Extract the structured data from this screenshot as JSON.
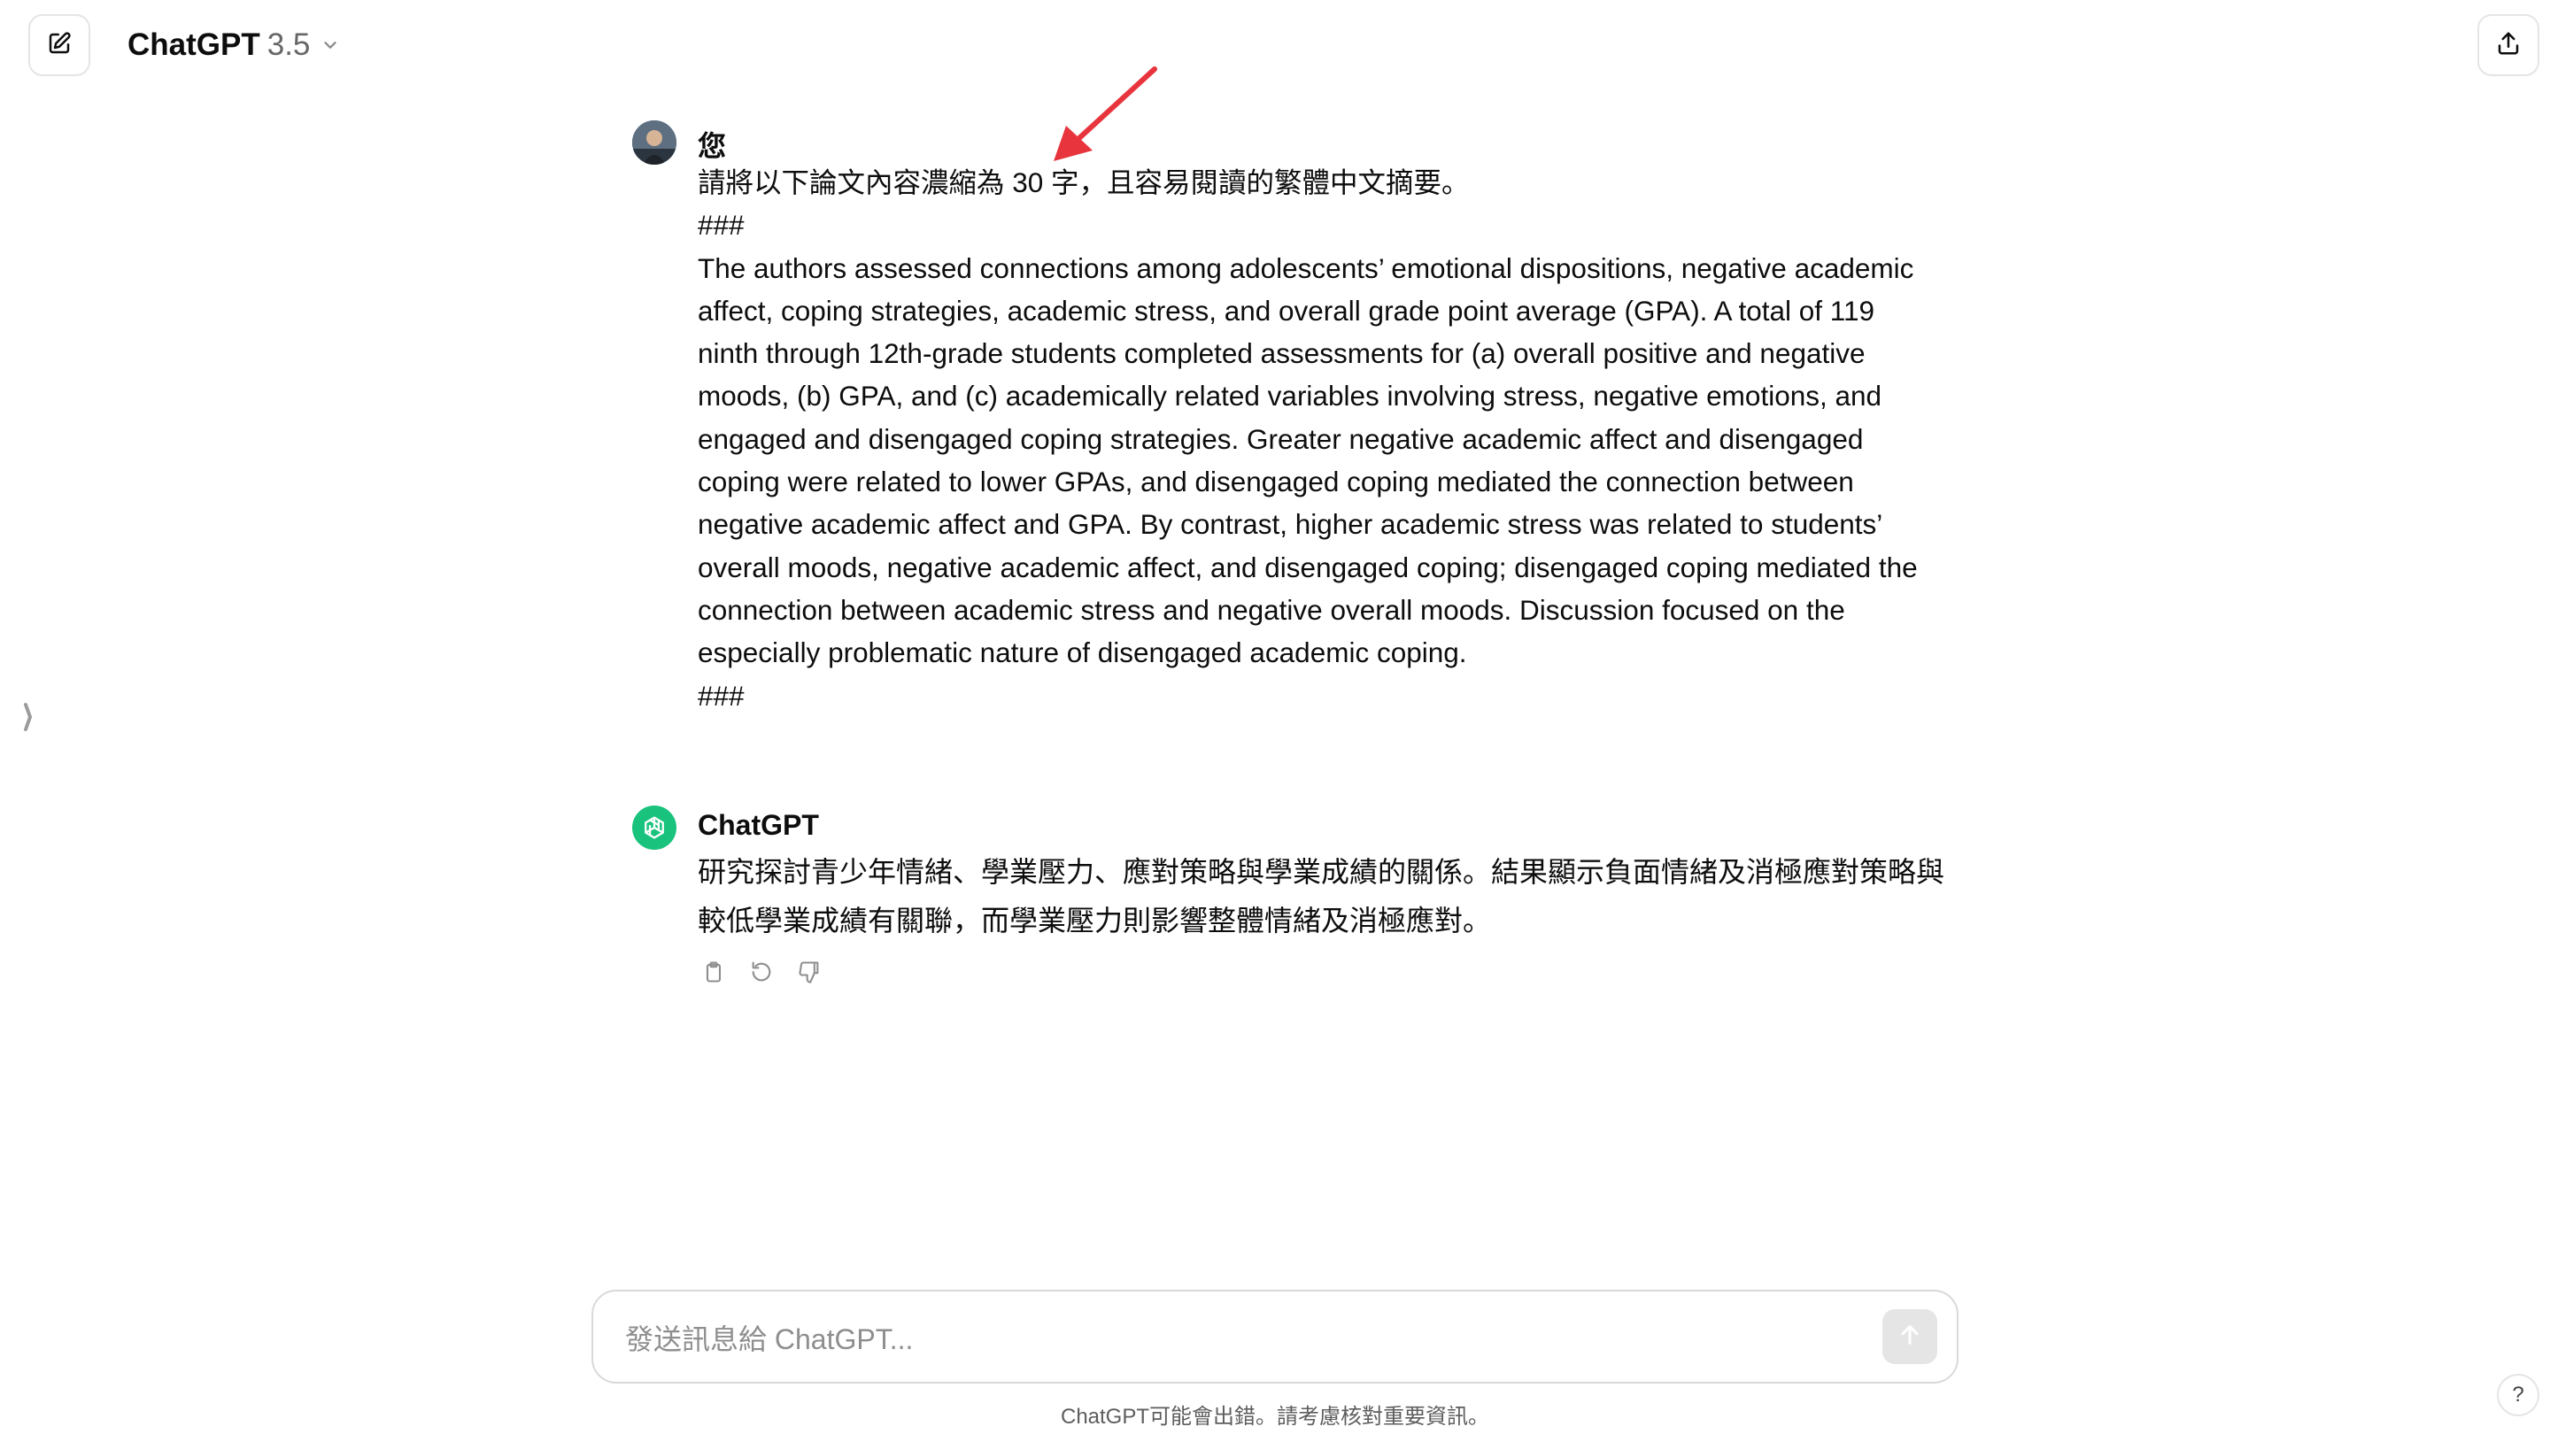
{
  "header": {
    "model_name": "ChatGPT",
    "model_version": "3.5"
  },
  "icons": {
    "new_chat": "edit-square-icon",
    "share": "share-upload-icon",
    "chevron": "chevron-down-icon",
    "sidebar_toggle": "sidebar-toggle-icon",
    "copy": "copy-clipboard-icon",
    "regenerate": "regenerate-icon",
    "thumbs_down": "thumbs-down-icon",
    "send": "arrow-up-icon",
    "openai_logo": "openai-logo-icon"
  },
  "conversation": {
    "user": {
      "author": "您",
      "instruction": "請將以下論文內容濃縮為 30 字，且容易閱讀的繁體中文摘要。",
      "delimiter_open": "###",
      "abstract": "The authors assessed connections among adolescents’ emotional dispositions, negative academic affect, coping strategies, academic stress, and overall grade point average (GPA). A total of 119 ninth through 12th-grade students completed assessments for (a) overall positive and negative moods, (b) GPA, and (c) academically related variables involving stress, negative emotions, and engaged and disengaged coping strategies. Greater negative academic affect and disengaged coping were related to lower GPAs, and disengaged coping mediated the connection between negative academic affect and GPA. By contrast, higher academic stress was related to students’ overall moods, negative academic affect, and disengaged coping; disengaged coping mediated the connection between academic stress and negative overall moods. Discussion focused on the especially problematic nature of disengaged academic coping.",
      "delimiter_close": "###"
    },
    "assistant": {
      "author": "ChatGPT",
      "reply": "研究探討青少年情緒、學業壓力、應對策略與學業成績的關係。結果顯示負面情緒及消極應對策略與較低學業成績有關聯，而學業壓力則影響整體情緒及消極應對。"
    }
  },
  "composer": {
    "placeholder": "發送訊息給 ChatGPT..."
  },
  "footer": {
    "disclaimer": "ChatGPT可能會出錯。請考慮核對重要資訊。",
    "help_label": "?"
  },
  "colors": {
    "accent_green": "#19c37d",
    "annotation_red": "#e8343c"
  }
}
